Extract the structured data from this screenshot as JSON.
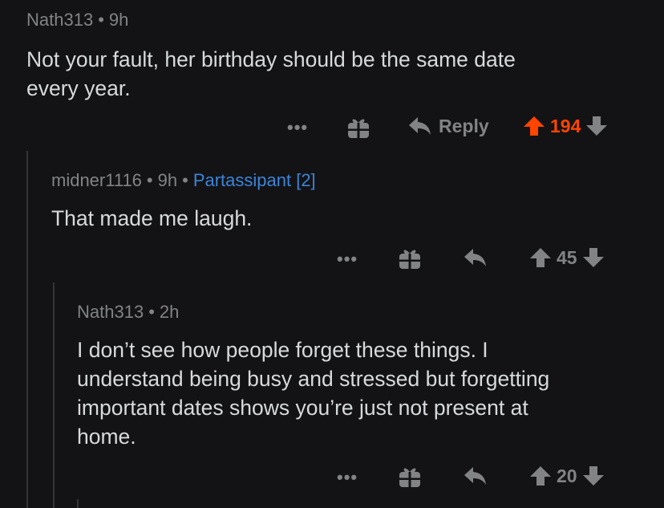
{
  "comments": [
    {
      "author": "Nath313",
      "age": "9h",
      "flair": "",
      "text_lines": [
        "Not your fault, her birthday should be the same date",
        "every year."
      ],
      "more": "•••",
      "reply_label": "Reply",
      "score": "194",
      "upvoted": true
    },
    {
      "author": "midner1116",
      "age": "9h",
      "flair": "Partassipant [2]",
      "text_lines": [
        "That made me laugh."
      ],
      "more": "•••",
      "reply_label": "",
      "score": "45",
      "upvoted": false
    },
    {
      "author": "Nath313",
      "age": "2h",
      "flair": "",
      "text_lines": [
        "I don’t see how people forget these things. I",
        "understand being busy and stressed but forgetting",
        "important dates shows you’re just not present at",
        "home."
      ],
      "more": "•••",
      "reply_label": "",
      "score": "20",
      "upvoted": false
    }
  ],
  "separator": "•",
  "colors": {
    "upvote_active": "#ff4500",
    "flair": "#3e84d8",
    "muted": "#818384"
  },
  "icons": {
    "more": "ellipsis-icon",
    "award": "gift-icon",
    "reply": "reply-arrow-icon",
    "upvote": "upvote-arrow-icon",
    "downvote": "downvote-arrow-icon"
  }
}
